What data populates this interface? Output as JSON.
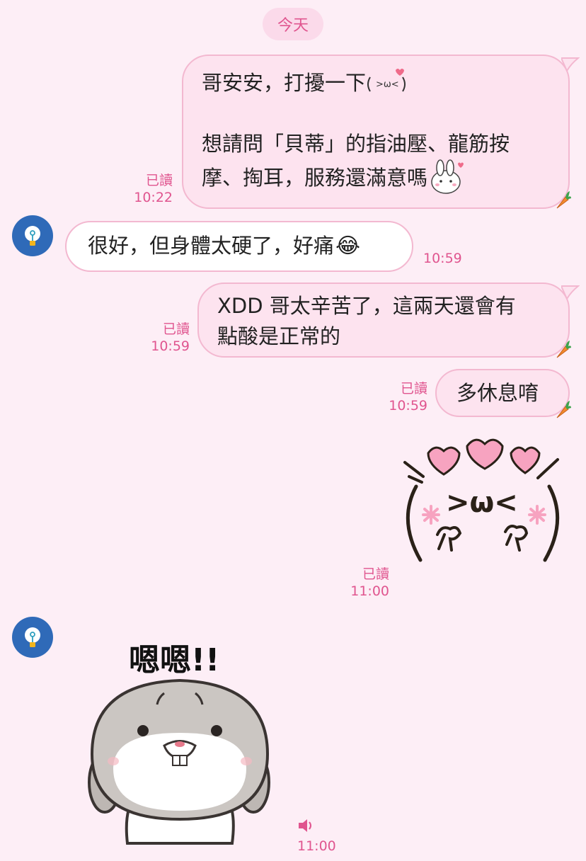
{
  "date_divider": "今天",
  "messages": [
    {
      "lines": [
        "哥安安，打擾一下",
        "",
        "想請問「貝蒂」的指油壓、龍筋按",
        "摩、掏耳，服務還滿意嗎"
      ],
      "read": "已讀",
      "time": "10:22"
    },
    {
      "lines": [
        "很好，但身體太硬了，好痛"
      ],
      "time": "10:59"
    },
    {
      "lines": [
        "XDD 哥太辛苦了，這兩天還會有",
        "點酸是正常的"
      ],
      "read": "已讀",
      "time": "10:59"
    },
    {
      "lines": [
        "多休息唷"
      ],
      "read": "已讀",
      "time": "10:59"
    },
    {
      "sticker": ">ω<",
      "read": "已讀",
      "time": "11:00"
    },
    {
      "sticker": "嗯嗯!!",
      "time": "11:00"
    }
  ],
  "icons": {
    "emoji_laugh": "😂",
    "sound": "speaker-icon"
  },
  "colors": {
    "accent": "#e0558f",
    "bg": "#fdeef6",
    "outgoing": "#fde3ef",
    "avatar": "#2f6ab8"
  }
}
